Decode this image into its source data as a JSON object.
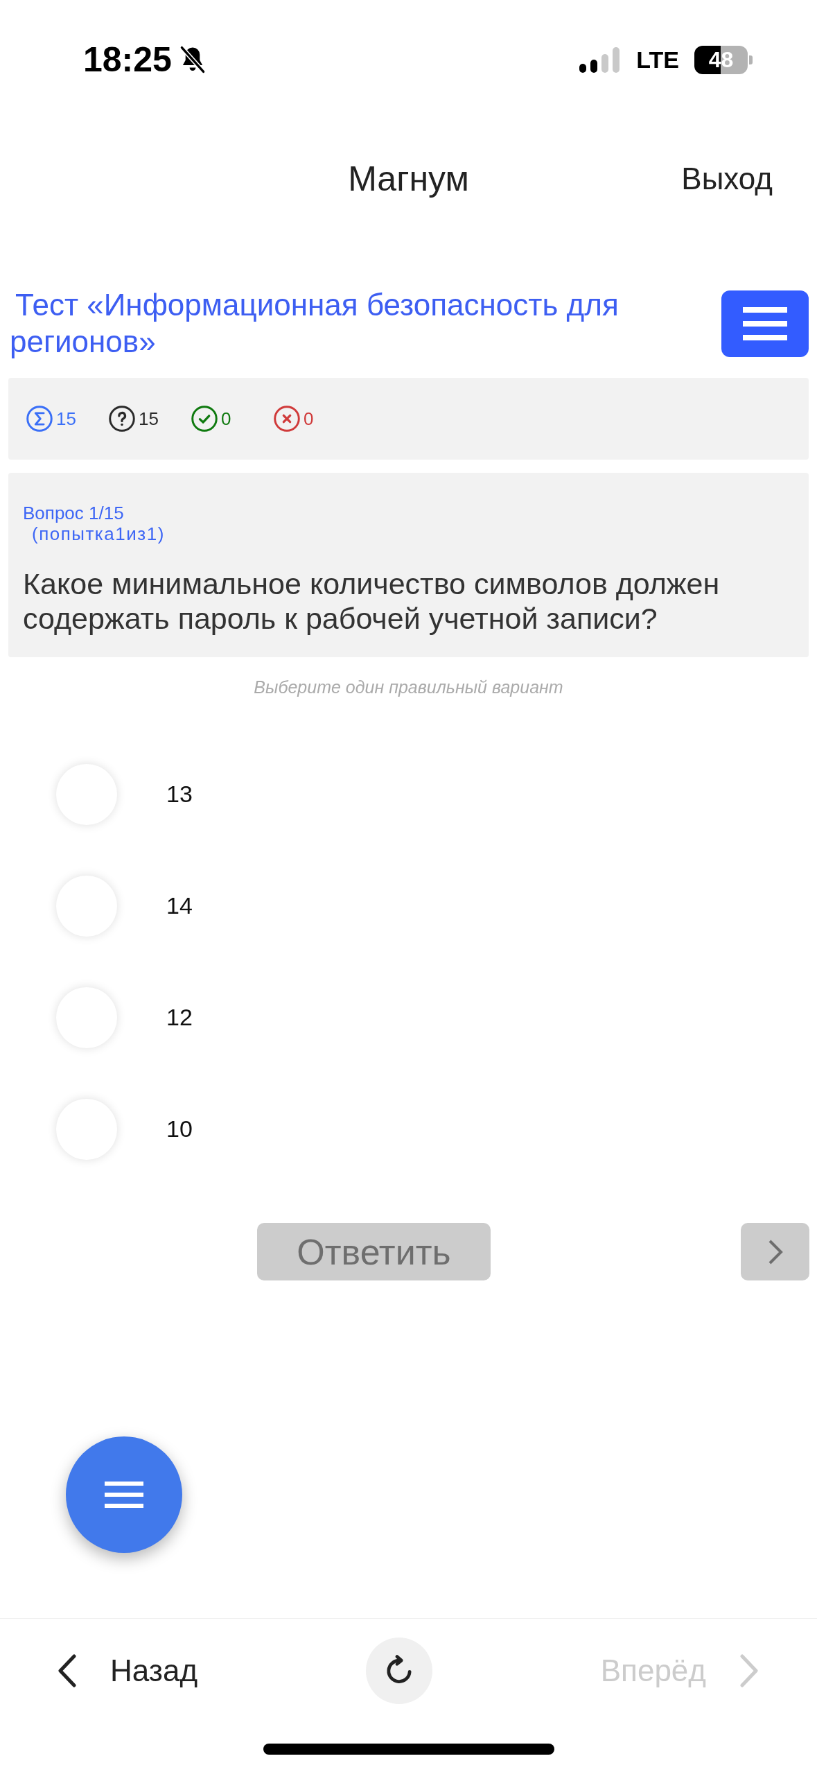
{
  "status_bar": {
    "time": "18:25",
    "network": "LTE",
    "battery": "48"
  },
  "header": {
    "title": "Магнум",
    "logout": "Выход"
  },
  "test": {
    "title": "Тест «Информационная безопасность для регионов»"
  },
  "stats": [
    {
      "kind": "total",
      "value": "15",
      "color": "#3a6ff7"
    },
    {
      "kind": "questions",
      "value": "15",
      "color": "#2b2b2b"
    },
    {
      "kind": "correct",
      "value": "0",
      "color": "#0f7a0f"
    },
    {
      "kind": "wrong",
      "value": "0",
      "color": "#d03a3a"
    }
  ],
  "question": {
    "number": "Вопрос 1/15",
    "attempt": "(попытка1из1)",
    "text": "Какое минимальное количество символов должен содержать пароль к рабочей учетной записи?"
  },
  "hint": "Выберите один правильный вариант",
  "options": [
    {
      "label": "13",
      "selected": false
    },
    {
      "label": "14",
      "selected": false
    },
    {
      "label": "12",
      "selected": false
    },
    {
      "label": "10",
      "selected": false
    }
  ],
  "answer_button": {
    "label": "Ответить",
    "disabled": true
  },
  "next_button": {
    "disabled": true
  },
  "bottom_nav": {
    "back": {
      "label": "Назад",
      "disabled": false
    },
    "forward": {
      "label": "Вперёд",
      "disabled": true
    }
  }
}
